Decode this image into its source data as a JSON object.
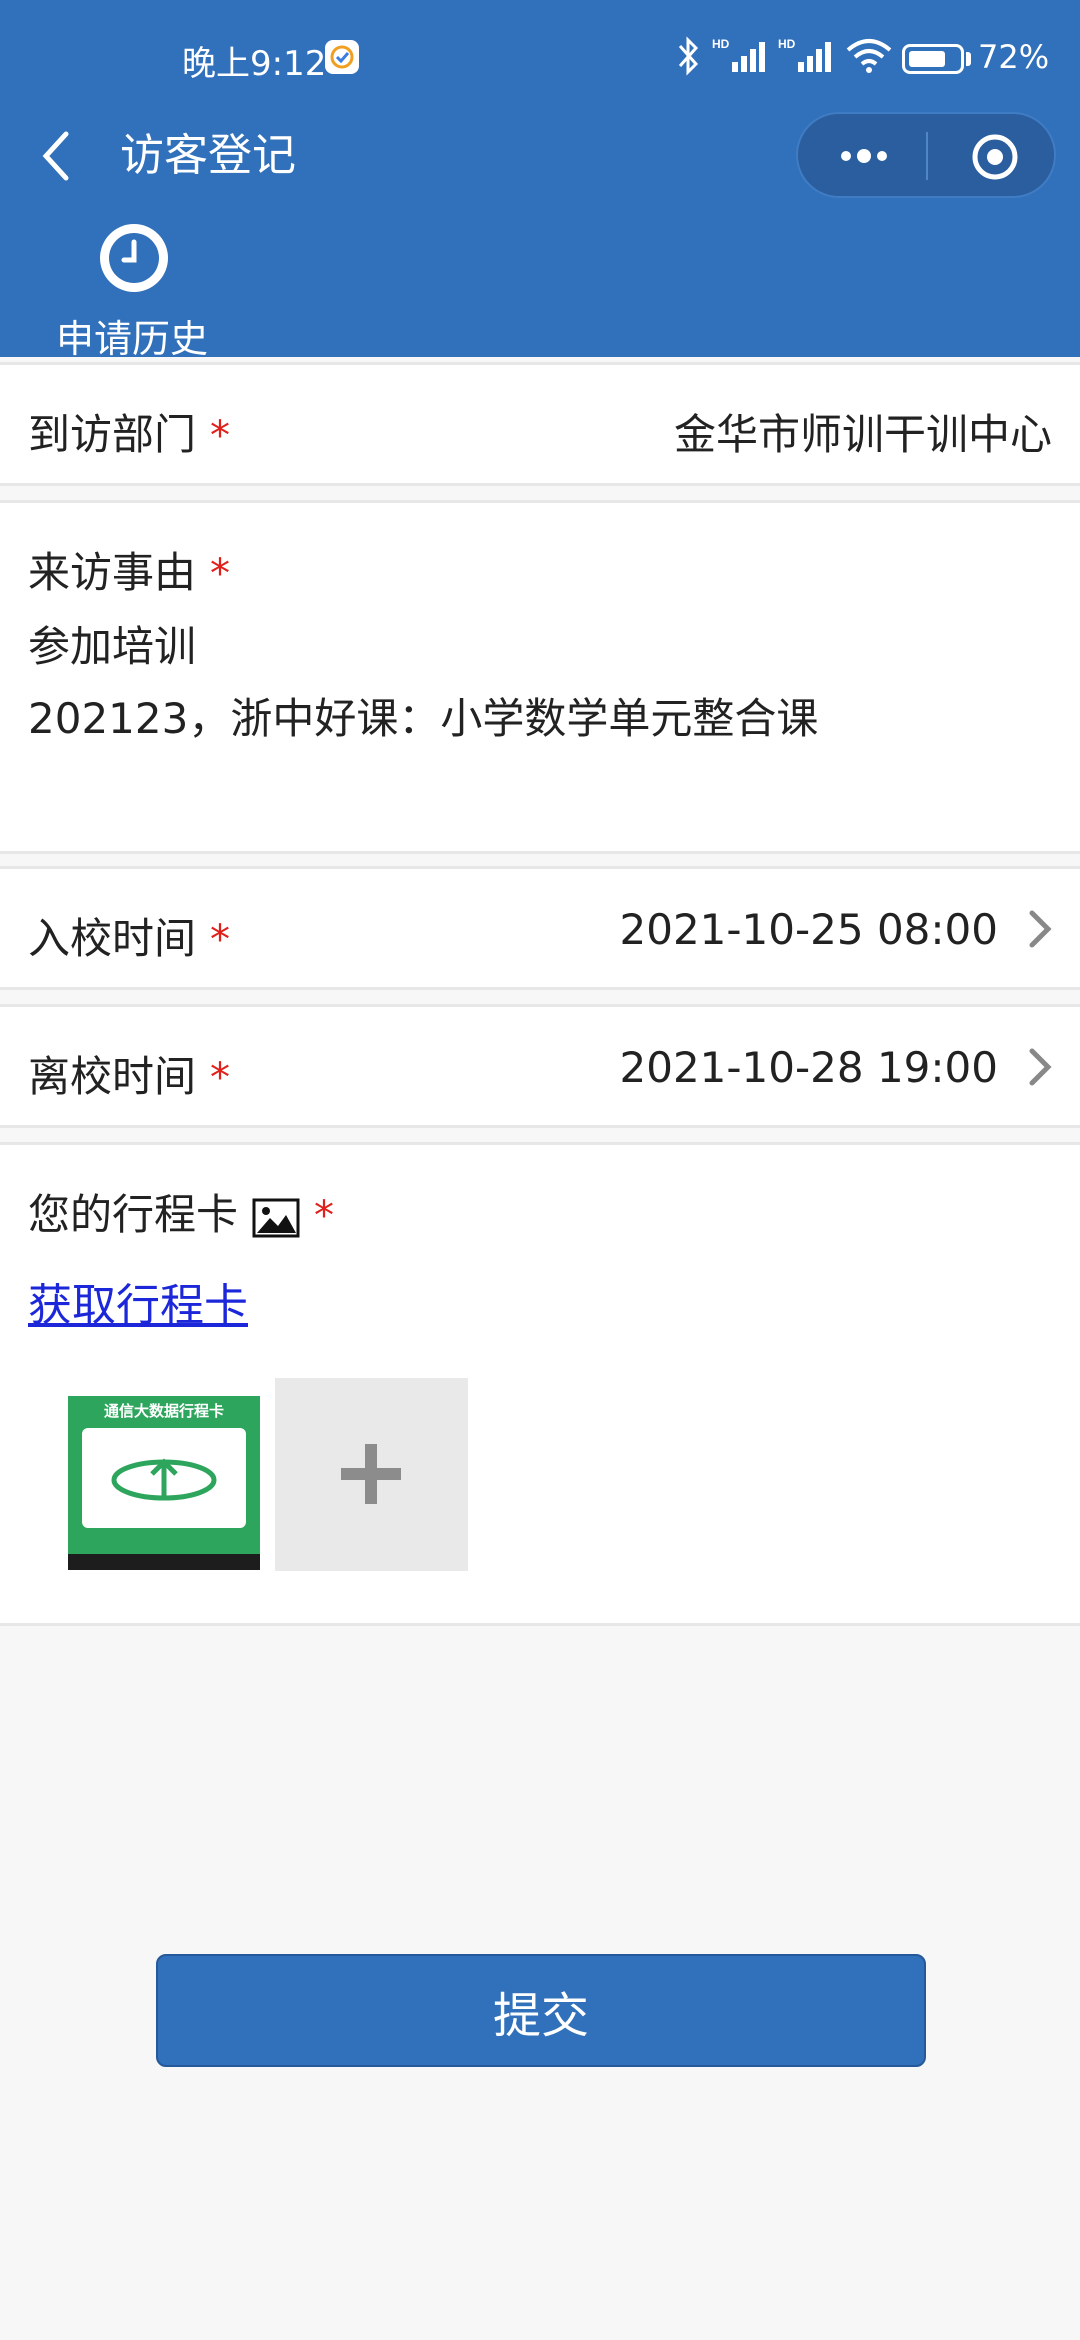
{
  "status_bar": {
    "time": "晚上9:12",
    "battery_level": 0.72,
    "battery_text": "72%",
    "icons": [
      "bluetooth-icon",
      "hd-signal-icon",
      "hd-signal-icon",
      "wifi-icon",
      "battery-icon"
    ]
  },
  "nav": {
    "title": "访客登记",
    "back_icon": "chevron-left-icon",
    "more_icon": "more-dots-icon",
    "close_icon": "target-circle-icon"
  },
  "history": {
    "label": "申请历史",
    "icon": "clock-icon"
  },
  "form": {
    "department": {
      "label": "到访部门",
      "required": "*",
      "value": "金华市师训干训中心"
    },
    "reason": {
      "label": "来访事由",
      "required": "*",
      "lines": [
        "参加培训",
        "202123，浙中好课：小学数学单元整合课"
      ]
    },
    "entry_time": {
      "label": "入校时间",
      "required": "*",
      "value": "2021-10-25 08:00"
    },
    "leave_time": {
      "label": "离校时间",
      "required": "*",
      "value": "2021-10-28 19:00"
    },
    "trip_card": {
      "label": "您的行程卡",
      "required": "*",
      "link": "获取行程卡",
      "thumb_title": "通信大数据行程卡"
    }
  },
  "submit": {
    "label": "提交"
  },
  "colors": {
    "brand": "#3170ba",
    "required": "#e0211b",
    "link": "#1b27d8"
  }
}
